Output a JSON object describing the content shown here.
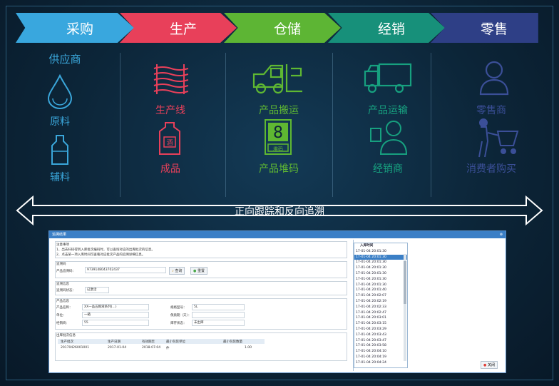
{
  "stages": [
    "采购",
    "生产",
    "仓储",
    "经销",
    "零售"
  ],
  "columns": {
    "supply": {
      "title": "供应商",
      "item1": "原料",
      "item2": "辅料"
    },
    "production": {
      "item1": "生产线",
      "item2": "成品"
    },
    "storage": {
      "item1": "产品搬运",
      "item2": "产品堆码",
      "stack_badge": "8",
      "stack_badge_sub": "堆码"
    },
    "distribution": {
      "item1": "产品运输",
      "item2": "经销商"
    },
    "retail": {
      "item1": "零售商",
      "item2": "消费者购买"
    }
  },
  "trace_arrow": {
    "label": "正向跟踪和反向追溯"
  },
  "colors": {
    "supply": "#3aa6da",
    "production": "#e8405a",
    "storage": "#5fb832",
    "distribution": "#17a07f",
    "retail": "#3b4f98"
  },
  "window": {
    "title": "追溯结果",
    "notes": [
      "注意事项",
      "1、出去扫码得到入库批次编码时，可以查询对应的出库批次的信息。",
      "2、点击某一项入库时间可查看对应批次产品的追溯详细信息。"
    ],
    "query_section": "追溯码",
    "product_code_label": "产品追溯码：",
    "product_code_value": "9739148043702437",
    "query_button": "查询",
    "reset_button": "重置",
    "batch_section": "追溯信息",
    "batch_label": "追溯码状态：",
    "batch_value": "已激活",
    "info_section": "产品信息",
    "product_name_label": "产品名称：",
    "product_name_value": "XX一品五粮液系列(...)",
    "spec_label": "规格型号：",
    "spec_value": "5L",
    "unit_label": "单位：",
    "unit_value": "一箱",
    "shelf_label": "保质期（天）：",
    "shelf_value": "",
    "dealer_label": "经销商：",
    "dealer_value": "55",
    "status_label": "库存状态：",
    "status_value": "未出库",
    "table_section": "出库批次信息",
    "headers": [
      "生产批次",
      "生产日期",
      "有效期至",
      "最小包装单位",
      "最小包装数量"
    ],
    "row": [
      "20170426001001",
      "2017-01-04",
      "2018-07-04",
      "件",
      "1.00"
    ],
    "list_header": "入库时间",
    "list_items": [
      "17-01-04 20:01:30",
      "17-01-04 20:01:30",
      "17-01-04 20:01:30",
      "17-01-04 20:01:30",
      "17-01-04 20:01:30",
      "17-01-04 20:01:30",
      "17-01-04 20:01:30",
      "17-01-04 20:01:40",
      "17-01-04 20:02:07",
      "17-01-04 20:02:19",
      "17-01-04 20:02:33",
      "17-01-04 20:02:47",
      "17-01-04 20:03:01",
      "17-01-04 20:03:15",
      "17-01-04 20:03:29",
      "17-01-04 20:03:43",
      "17-01-04 20:03:47",
      "17-01-04 20:03:58",
      "17-01-04 20:04:10",
      "17-01-04 20:04:19",
      "17-01-04 20:04:24"
    ],
    "selected_index": 1,
    "close_button": "关闭"
  }
}
